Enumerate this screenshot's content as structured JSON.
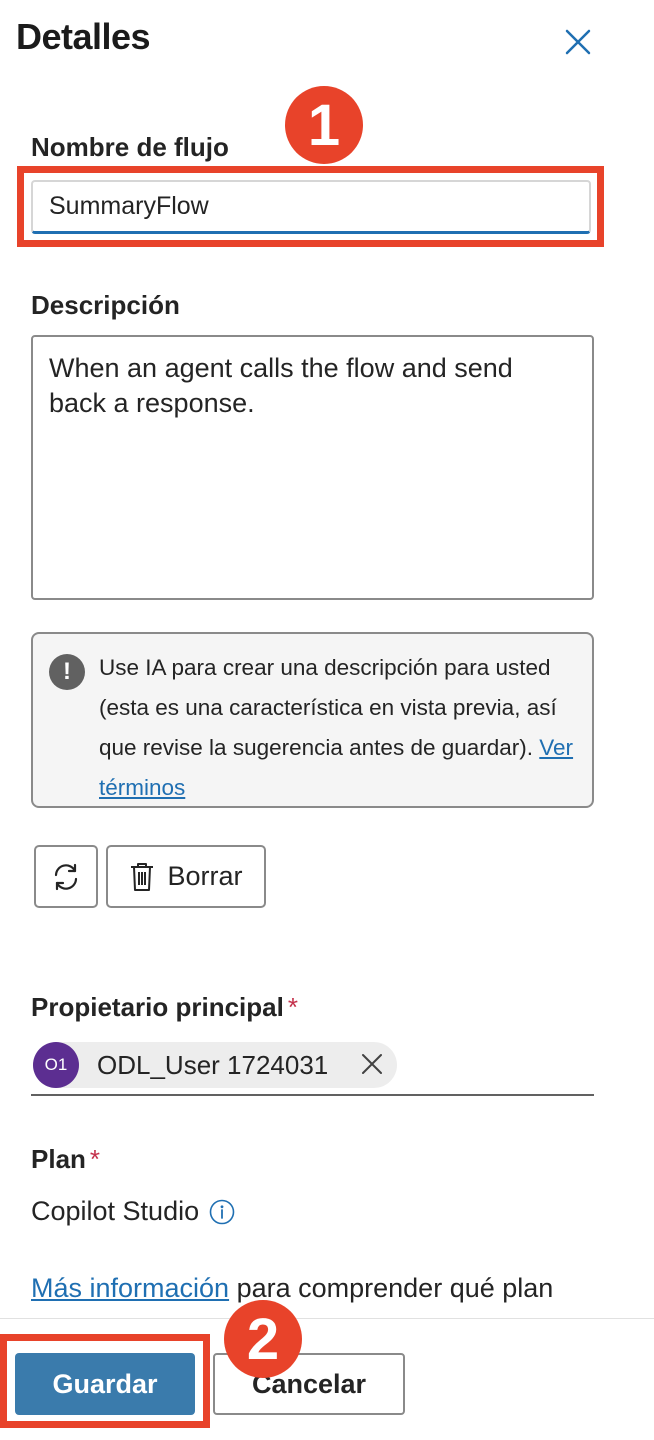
{
  "panel": {
    "title": "Detalles"
  },
  "flow_name": {
    "label": "Nombre de flujo",
    "value": "SummaryFlow"
  },
  "description": {
    "label": "Descripción",
    "value": "When an agent calls the flow and send back a response."
  },
  "ai_notice": {
    "text": "Use IA para crear una descripción para usted (esta es una característica en vista previa, así que revise la sugerencia antes de guardar).",
    "link": "Ver términos"
  },
  "actions": {
    "clear_label": "Borrar"
  },
  "owner": {
    "label": "Propietario principal",
    "required_mark": "*",
    "chip_initials": "O1",
    "chip_name": "ODL_User 1724031"
  },
  "plan": {
    "label": "Plan",
    "required_mark": "*",
    "value": "Copilot Studio"
  },
  "more_info": {
    "link": "Más información",
    "text": " para comprender qué plan"
  },
  "footer": {
    "save_label": "Guardar",
    "cancel_label": "Cancelar"
  },
  "annotations": {
    "step1": "1",
    "step2": "2"
  },
  "colors": {
    "accent": "#1f6fb2",
    "primary_button": "#3a7bac",
    "annotation": "#e8432a",
    "avatar": "#5c2e91",
    "required": "#c4314b"
  },
  "icons": [
    "close-icon",
    "warning-icon",
    "refresh-icon",
    "trash-icon",
    "remove-icon",
    "info-icon"
  ]
}
